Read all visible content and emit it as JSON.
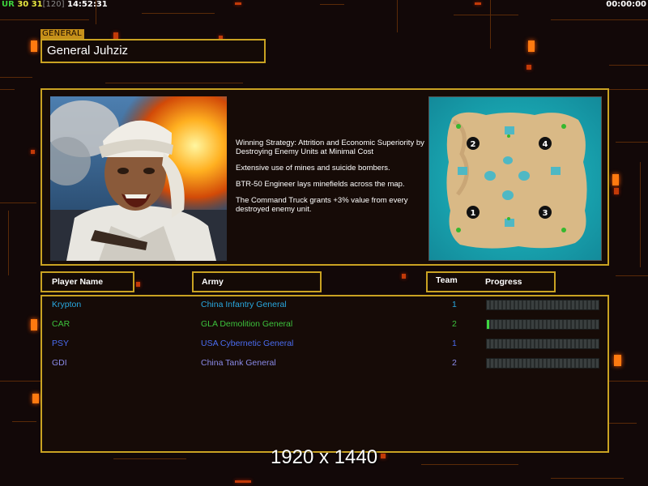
{
  "hud": {
    "ur_label": "UR",
    "fps": "30",
    "fps2": "31",
    "fps_limit": "[120]",
    "clock": "14:52:31",
    "game_timer": "00:00:00"
  },
  "general": {
    "tag": "GENERAL",
    "name": "General Juhziz",
    "strategy": [
      "Winning Strategy: Attrition and Economic Superiority by Destroying Enemy Units at Minimal Cost",
      "Extensive use of mines and suicide bombers.",
      "BTR-50 Engineer lays minefields across the map.",
      "The Command Truck grants +3% value from every destroyed enemy unit."
    ]
  },
  "minimap": {
    "start_positions": [
      "1",
      "2",
      "3",
      "4"
    ]
  },
  "columns": {
    "player_name": "Player Name",
    "army": "Army",
    "team": "Team",
    "progress": "Progress"
  },
  "players": [
    {
      "name": "Krypton",
      "army": "China Infantry General",
      "team": "1",
      "progress": 0.0,
      "color": "#28a8e0"
    },
    {
      "name": "CAR",
      "army": "GLA Demolition General",
      "team": "2",
      "progress": 0.02,
      "color": "#3cc23c"
    },
    {
      "name": "PSY",
      "army": "USA Cybernetic General",
      "team": "1",
      "progress": 0.0,
      "color": "#4a6cf0"
    },
    {
      "name": "GDI",
      "army": "China Tank General",
      "team": "2",
      "progress": 0.0,
      "color": "#8a8ae8"
    }
  ],
  "resolution_label": "1920 x 1440",
  "colors": {
    "frame_gold": "#c9a222",
    "background": "#120808",
    "glow_orange": "#ff7a10"
  }
}
